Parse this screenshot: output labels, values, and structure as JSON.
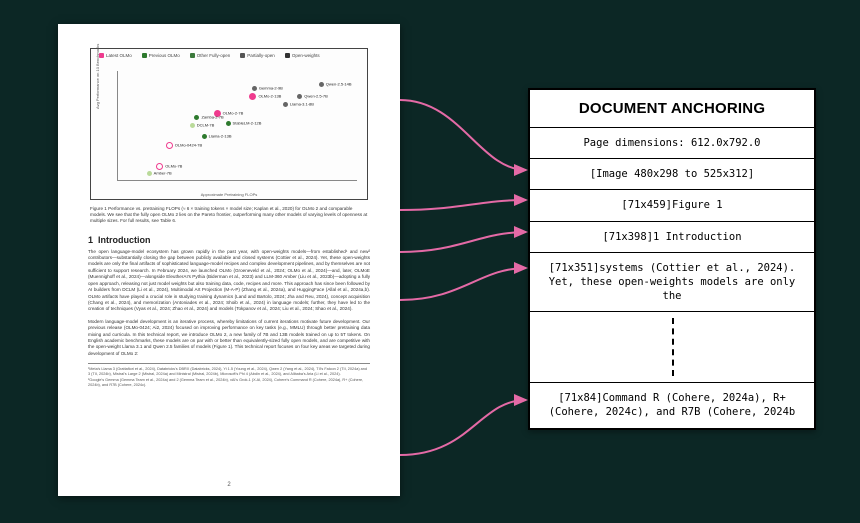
{
  "doc": {
    "caption": "Figure 1  Performance vs. pretraining FLOPs (≈ 6 × training tokens × model size; Kaplan et al., 2020) for OLMo 2 and comparable models. We see that the fully open OLMo 2 lies on the Pareto frontier, outperforming many other models of varying levels of openness at multiple sizes. For full results, see Table 6.",
    "section_number": "1",
    "section_title": "Introduction",
    "para1": "The open language-model ecosystem has grown rapidly in the past year, with open-weights models—from established¹ and new² contributors—substantially closing the gap between publicly available and closed systems (Cottier et al., 2024). Yet, these open-weights models are only the final artifacts of sophisticated language-model recipes and complex development pipelines, and by themselves are not sufficient to support research. In February 2024, we launched OLMo (Groeneveld et al., 2024; OLMo et al., 2024)—and, later, OLMoE (Muennighoff et al., 2024)—alongside EleutherAI's Pythia (Biderman et al., 2023) and LLM-360 Amber (Liu et al., 2023b)—adopting a fully open approach, releasing not just model weights but also training data, code, recipes and more. This approach has since been followed by AI builders from DCLM (Li et al., 2024), Multimodal Art Projection (M-A-P) (Zhang et al., 2024a), and HuggingFace (Allal et al., 2024a,b). OLMo artifacts have played a crucial role in studying training dynamics (Land and Bartolo, 2024; Jha and Reu, 2024), concept acquisition (Chang et al., 2024), and memorization (Antoniades et al., 2024; Shoib et al., 2024) in language models; further, they have led to the creation of techniques (Vyas et al., 2024; Zhao et al., 2024) and models (Tokpanov et al., 2024; Liu et al., 2024; Shao et al., 2024).",
    "para2": "Modern language-model development is an iterative process, whereby limitations of current iterations motivate future development. Our previous release (OLMo-0424; Ai2, 2024) focused on improving performance on key tasks (e.g., MMLU) through better pretraining data mixing and curricula. In this technical report, we introduce OLMo 2, a new family of 7B and 13B models trained on up to 5T tokens. On English academic benchmarks, these models are on par with or better than equivalently-sized fully open models, and are competitive with the open-weight Llama 3.1 and Qwen 2.5 families of models (Figure 1). This technical report focuses on four key areas we targeted during development of OLMo 2:",
    "footnote1": "¹Meta's Llama 3 (Grattafiori et al., 2024), Databricks's DBRX (Databricks, 2024), Yi 1.5 (Young et al., 2024), Qwen 2 (Yang et al., 2024), TII's Falcon 2 (TII, 2024a) and 3 (TII, 2024b), Mistral's Large 2 (Mistral, 2024a) and Ministral (Mistral, 2024b), Microsoft's Phi 4 (Abdin et al., 2024), and Alibaba's Aria (Li et al., 2024).",
    "footnote2": "²Google's Gemma (Gemma Team et al., 2024a) and 2 (Gemma Team et al., 2024b), xAI's Grok-1 (X.AI, 2024), Cohere's Command R (Cohere, 2024a), R+ (Cohere, 2024b), and R7B (Cohere, 2024c).",
    "page_number": "2",
    "chart": {
      "ylabel": "Avg Performance on 10 Benchmarks",
      "xlabel": "Approximate Pretraining FLOPs",
      "legend": [
        "Latest OLMo",
        "Previous OLMo",
        "Other Fully-open",
        "Partially-open",
        "Open-weights"
      ],
      "points": [
        {
          "label": "OLMo-2-13B",
          "cls": "pink",
          "x": 55,
          "y": 20
        },
        {
          "label": "OLMo-2-7B",
          "cls": "pink",
          "x": 40,
          "y": 36
        },
        {
          "label": "OLMo-0424-7B",
          "cls": "hpink",
          "x": 20,
          "y": 65
        },
        {
          "label": "OLMo-7B",
          "cls": "hpink",
          "x": 16,
          "y": 84
        },
        {
          "label": "Llama-3.1-8B",
          "cls": "gry",
          "x": 69,
          "y": 28
        },
        {
          "label": "Gemma-2-9B",
          "cls": "gry",
          "x": 56,
          "y": 14
        },
        {
          "label": "Qwen-2.5-7B",
          "cls": "gry",
          "x": 75,
          "y": 21
        },
        {
          "label": "Qwen-2.5-14B",
          "cls": "gry",
          "x": 84,
          "y": 10
        },
        {
          "label": "Llama-2-13B",
          "cls": "grn",
          "x": 35,
          "y": 58
        },
        {
          "label": "DCLM-7B",
          "cls": "pale",
          "x": 30,
          "y": 48
        },
        {
          "label": "StableLM-2-12B",
          "cls": "grn",
          "x": 45,
          "y": 46
        },
        {
          "label": "Zamba-2-7B",
          "cls": "grn",
          "x": 32,
          "y": 40
        },
        {
          "label": "Amber-7B",
          "cls": "pale",
          "x": 12,
          "y": 92
        }
      ]
    }
  },
  "anchor": {
    "title": "DOCUMENT ANCHORING",
    "rows": [
      "Page dimensions: 612.0x792.0",
      "[Image 480x298 to 525x312]",
      "[71x459]Figure 1",
      "[71x398]1 Introduction",
      "[71x351]systems (Cottier et al., 2024). Yet, these open-weights models are only the"
    ],
    "last_row": "[71x84]Command R (Cohere, 2024a), R+ (Cohere, 2024c), and R7B (Cohere, 2024b"
  },
  "arrow_color": "#e46aa6"
}
